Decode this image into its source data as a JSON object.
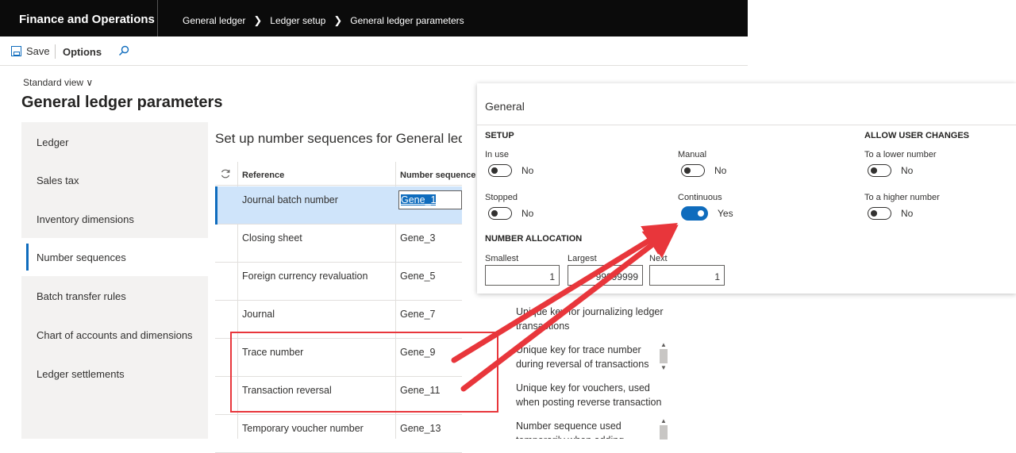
{
  "header": {
    "app_title": "Finance and Operations",
    "breadcrumb": [
      "General ledger",
      "Ledger setup",
      "General ledger parameters"
    ]
  },
  "toolbar": {
    "save_label": "Save",
    "options_label": "Options",
    "search_icon": "search-icon"
  },
  "page": {
    "view_label": "Standard view",
    "title": "General ledger parameters"
  },
  "sidebar": {
    "items": [
      {
        "label": "Ledger",
        "active": false
      },
      {
        "label": "Sales tax",
        "active": false
      },
      {
        "label": "Inventory dimensions",
        "active": false
      },
      {
        "label": "Number sequences",
        "active": true
      },
      {
        "label": "Batch transfer rules",
        "active": false
      },
      {
        "label": "Chart of accounts and dimensions",
        "active": false
      },
      {
        "label": "Ledger settlements",
        "active": false
      }
    ]
  },
  "main": {
    "section_title": "Set up number sequences for General ledger",
    "columns": {
      "reference": "Reference",
      "number_sequence": "Number sequence code"
    },
    "rows": [
      {
        "reference": "Journal batch number",
        "code": "Gene_1",
        "description": ""
      },
      {
        "reference": "Closing sheet",
        "code": "Gene_3",
        "description": ""
      },
      {
        "reference": "Foreign currency revaluation",
        "code": "Gene_5",
        "description": ""
      },
      {
        "reference": "Journal",
        "code": "Gene_7",
        "description": "Unique key for journalizing ledger transactions"
      },
      {
        "reference": "Trace number",
        "code": "Gene_9",
        "description": "Unique key for trace number during reversal of transactions"
      },
      {
        "reference": "Transaction reversal",
        "code": "Gene_11",
        "description": "Unique key for vouchers, used when posting reverse transaction"
      },
      {
        "reference": "Temporary voucher number",
        "code": "Gene_13",
        "description": "Number sequence used temporarily when adding"
      }
    ]
  },
  "panel": {
    "title": "General",
    "setup_heading": "SETUP",
    "in_use": {
      "label": "In use",
      "value": "No"
    },
    "manual": {
      "label": "Manual",
      "value": "No"
    },
    "stopped": {
      "label": "Stopped",
      "value": "No"
    },
    "continuous": {
      "label": "Continuous",
      "value": "Yes"
    },
    "allow_heading": "ALLOW USER CHANGES",
    "to_lower": {
      "label": "To a lower number",
      "value": "No"
    },
    "to_higher": {
      "label": "To a higher number",
      "value": "No"
    },
    "allocation_heading": "NUMBER ALLOCATION",
    "smallest": {
      "label": "Smallest",
      "value": "1"
    },
    "largest": {
      "label": "Largest",
      "value": "99999999"
    },
    "next": {
      "label": "Next",
      "value": "1"
    }
  },
  "colors": {
    "accent": "#0f6cbd",
    "annotation": "#e8363b",
    "topbar": "#0b0b0b"
  }
}
